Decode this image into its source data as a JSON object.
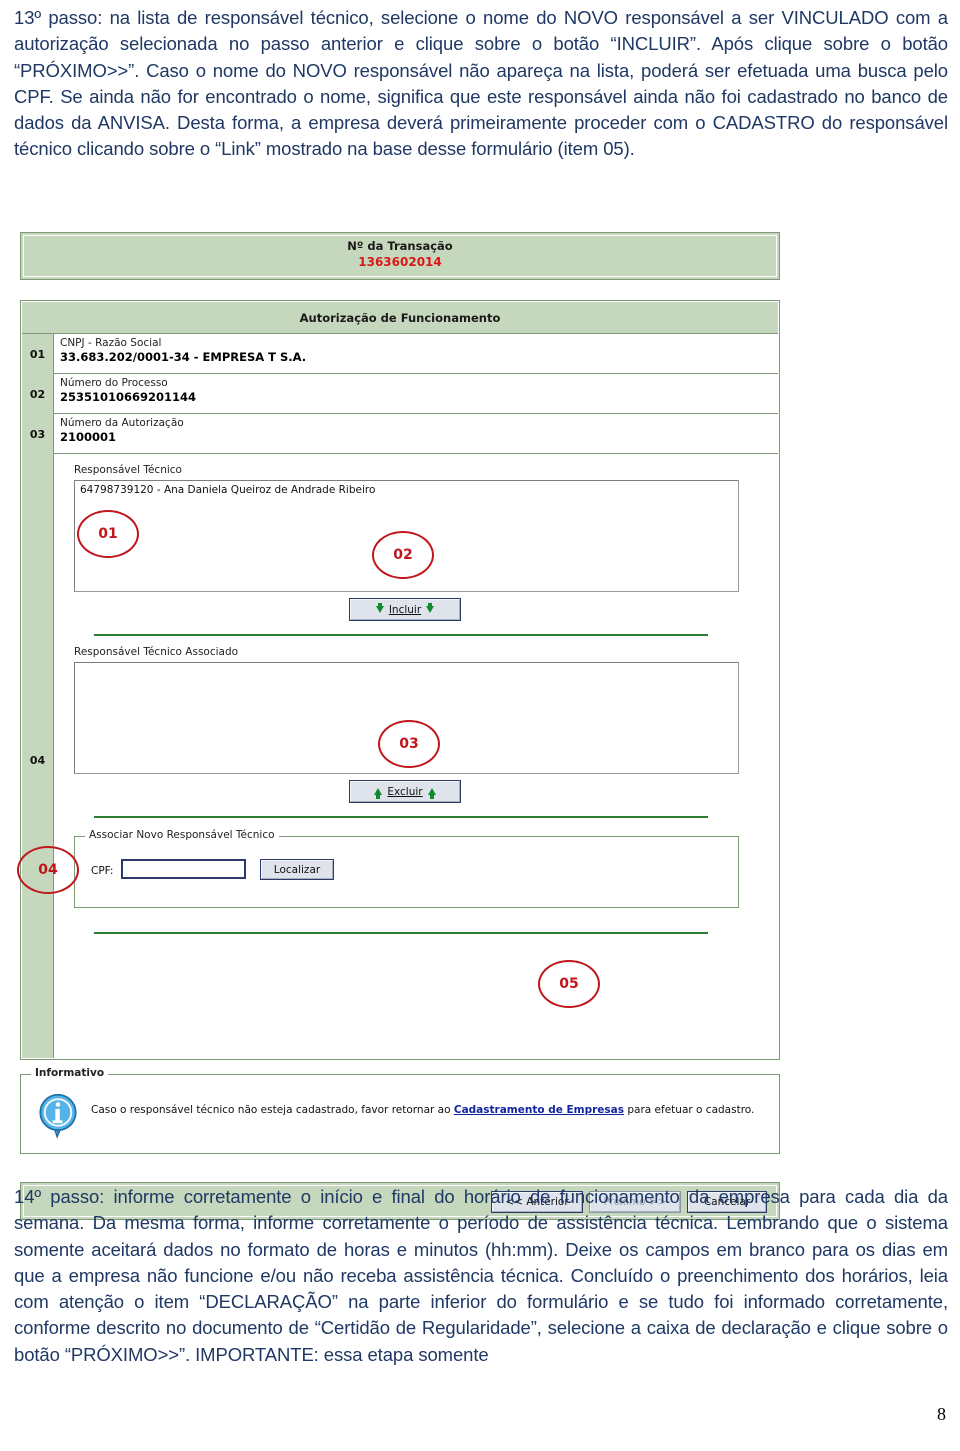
{
  "document": {
    "paragraph_top": "13º passo: na lista de responsável técnico, selecione o nome do NOVO responsável a ser VINCULADO com a autorização selecionada no passo anterior e clique sobre o botão “INCLUIR”. Após clique sobre o botão “PRÓXIMO>>”. Caso o nome do NOVO responsável não apareça na lista, poderá ser efetuada uma busca pelo CPF. Se ainda não for encontrado o nome, significa que este responsável ainda não foi cadastrado no banco de dados da ANVISA. Desta forma, a empresa deverá primeiramente proceder com o CADASTRO do responsável técnico clicando sobre o “Link” mostrado na base desse formulário (item 05).",
    "paragraph_bottom": "14º passo: informe corretamente o início e final do horário de funcionamento da empresa para cada dia da semana. Da mesma forma, informe corretamente o período de assistência técnica. Lembrando que o sistema somente aceitará dados no formato de horas e minutos (hh:mm). Deixe os campos em branco para os dias em que a empresa não funcione e/ou não receba assistência técnica. Concluído o preenchimento dos horários, leia com atenção o item “DECLARAÇÃO” na parte inferior do formulário e se tudo foi informado corretamente, conforme descrito no documento de “Certidão de Regularidade”, selecione a caixa de declaração e clique sobre o botão “PRÓXIMO>>”. IMPORTANTE: essa etapa somente",
    "page_number": "8"
  },
  "screenshot": {
    "transaction": {
      "label": "Nº da Transação",
      "value": "1363602014",
      "value_color": "#d81818"
    },
    "form_title": "Autorização de Funcionamento",
    "fields": [
      {
        "num": "01",
        "caption": "CNPJ - Razão Social",
        "value": "33.683.202/0001-34 - EMPRESA T S.A."
      },
      {
        "num": "02",
        "caption": "Número do Processo",
        "value": "25351010669201144"
      },
      {
        "num": "03",
        "caption": "Número da Autorização",
        "value": "2100001"
      }
    ],
    "gutter_extra_num": "04",
    "responsavel_tecnico": {
      "caption": "Responsável Técnico",
      "items": [
        "64798739120 - Ana Daniela Queiroz de Andrade Ribeiro"
      ]
    },
    "incluir_button": {
      "label": "Incluir",
      "icon": "green-down-arrow-icon"
    },
    "responsavel_associado": {
      "caption": "Responsável Técnico Associado",
      "items": []
    },
    "excluir_button": {
      "label": "Excluir",
      "icon": "green-up-arrow-icon"
    },
    "associar_group": {
      "legend": "Associar Novo Responsável Técnico",
      "cpf_label": "CPF:",
      "cpf_value": "",
      "cpf_placeholder": "",
      "localizar_button": "Localizar"
    },
    "informativo": {
      "legend": "Informativo",
      "icon": "info-icon",
      "text_before": "Caso o responsável técnico não esteja cadastrado, favor retornar ao ",
      "link": "Cadastramento de Empresas",
      "text_after": " para efetuar o cadastro.",
      "link_color": "#12239e"
    },
    "nav_buttons": {
      "previous": "<< Anterior",
      "next": "Próximo >>",
      "next_disabled": true,
      "cancel": "Cancelar"
    },
    "annotations": [
      {
        "id": "01",
        "label": "01"
      },
      {
        "id": "02",
        "label": "02"
      },
      {
        "id": "03",
        "label": "03"
      },
      {
        "id": "04",
        "label": "04"
      },
      {
        "id": "05",
        "label": "05"
      }
    ],
    "colors": {
      "panel_green": "#c5d7bc",
      "border_green": "#7d9b76",
      "annotation_red": "#c0171c",
      "rule_green": "#2e7d32"
    }
  }
}
